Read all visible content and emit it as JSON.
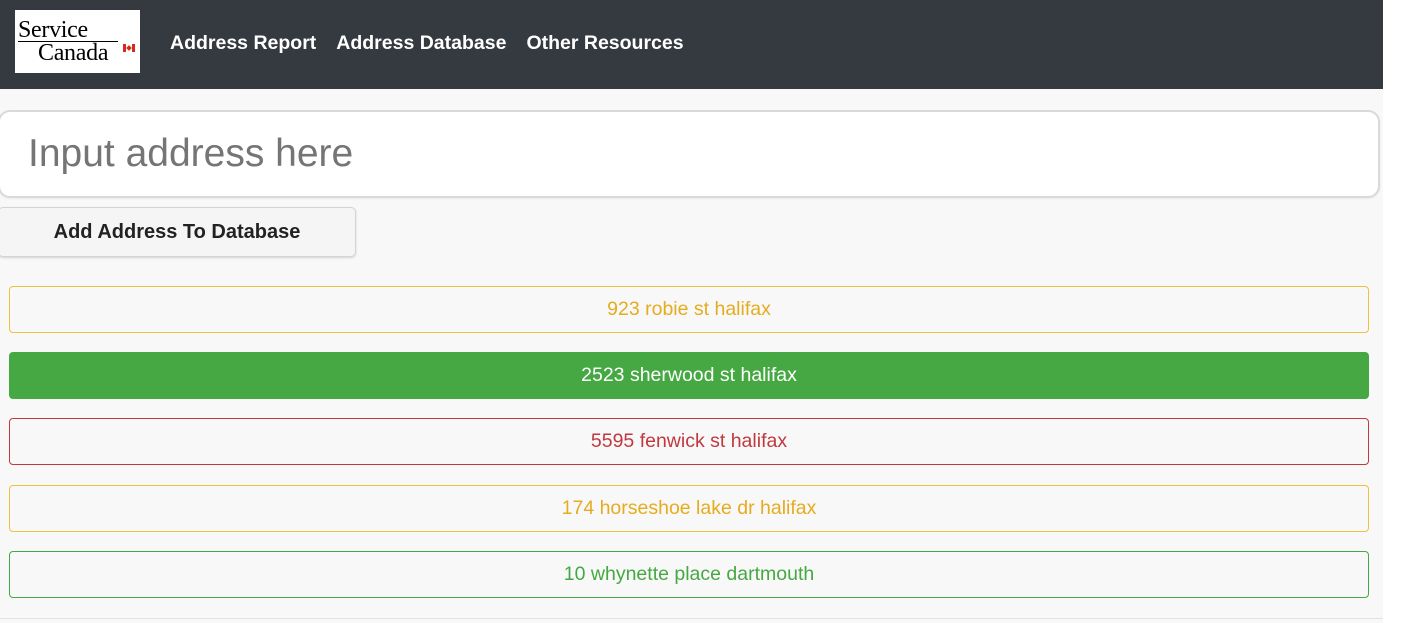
{
  "logo": {
    "line1": "Service",
    "line2": "Canada"
  },
  "nav": {
    "items": [
      {
        "label": "Address Report"
      },
      {
        "label": "Address Database"
      },
      {
        "label": "Other Resources"
      }
    ]
  },
  "search": {
    "placeholder": "Input address here",
    "value": ""
  },
  "actions": {
    "add_label": "Add Address To Database"
  },
  "addresses": [
    {
      "text": "923 robie st halifax",
      "status": "warning"
    },
    {
      "text": "2523 sherwood st halifax",
      "status": "success-active"
    },
    {
      "text": "5595 fenwick st halifax",
      "status": "danger"
    },
    {
      "text": "174 horseshoe lake dr halifax",
      "status": "warning"
    },
    {
      "text": "10 whynette place dartmouth",
      "status": "success"
    }
  ],
  "colors": {
    "navbar": "#343a40",
    "warning": "#e6ac1f",
    "success": "#45a842",
    "danger": "#c0393f"
  }
}
